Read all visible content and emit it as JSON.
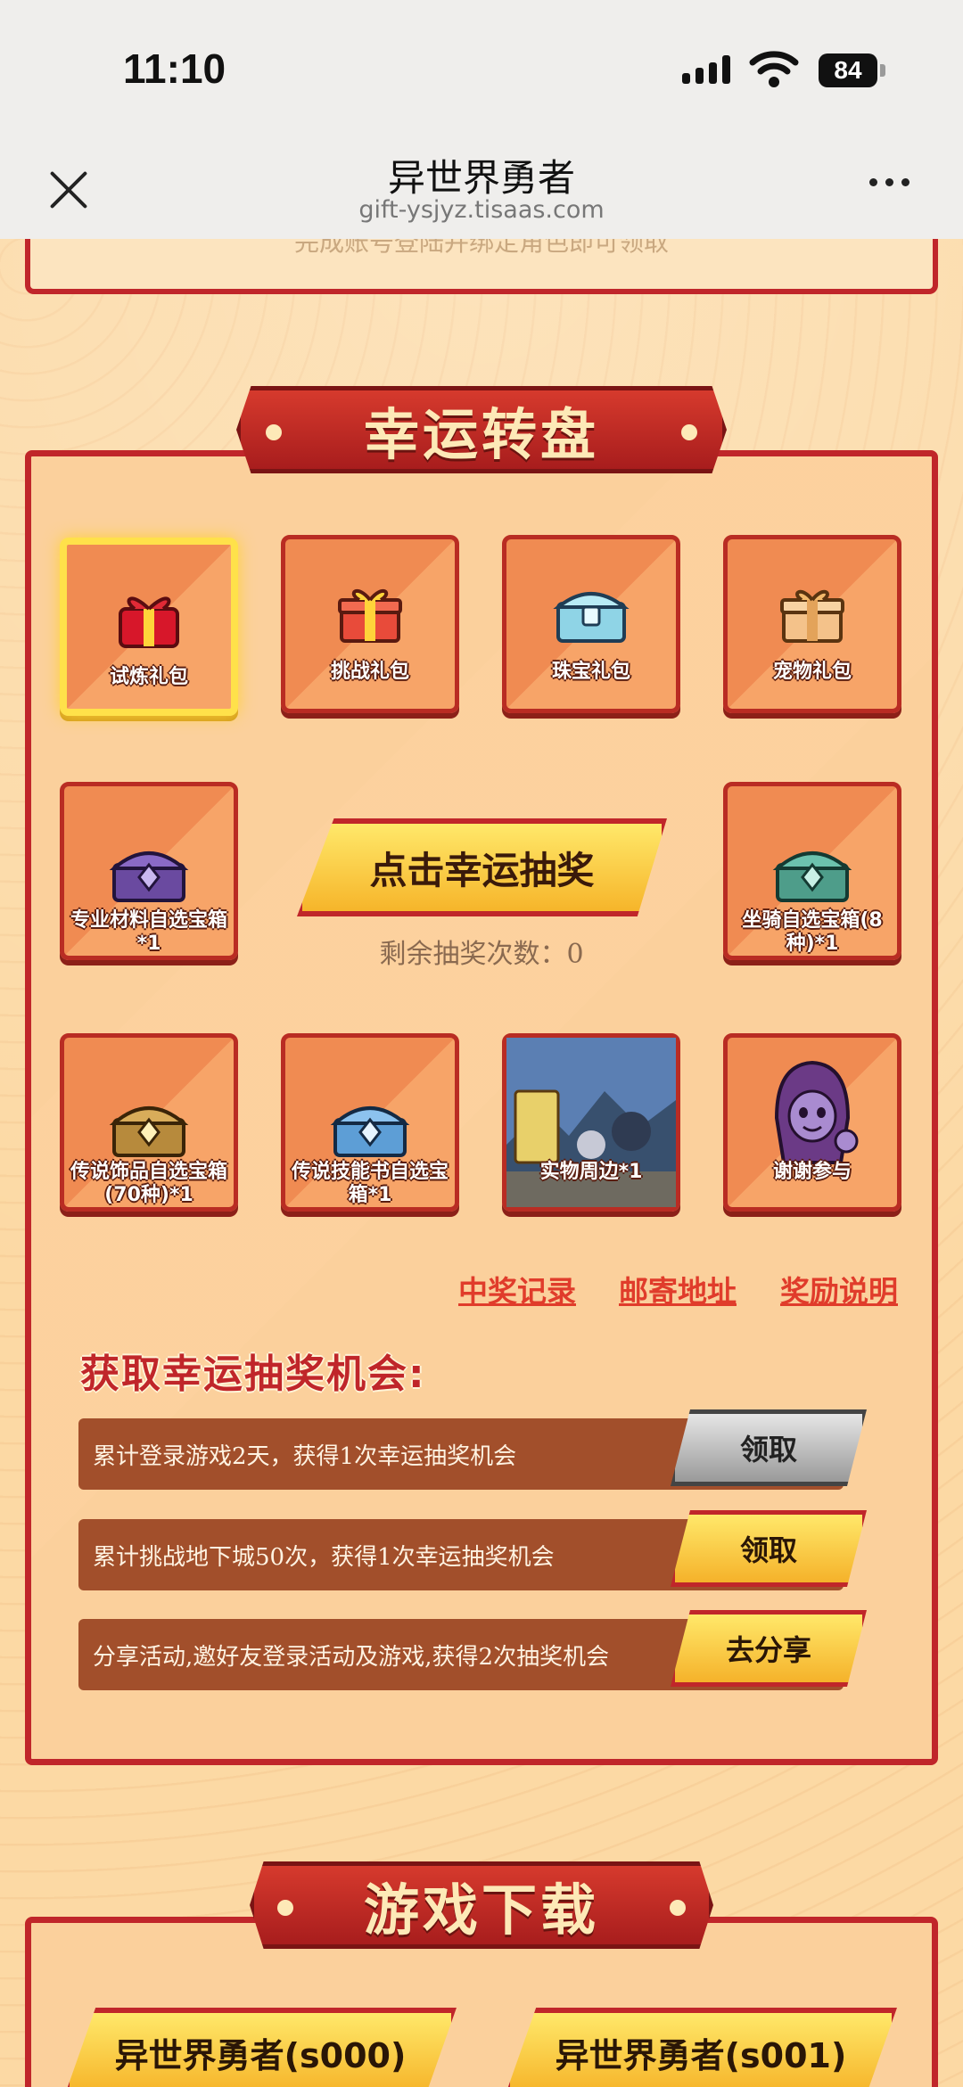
{
  "status_bar": {
    "time": "11:10",
    "battery": "84"
  },
  "browser": {
    "title": "异世界勇者",
    "url": "gift-ysjyz.tisaas.com"
  },
  "top_panel": {
    "note": "完成账号登陆并绑定角色即可领取"
  },
  "lucky_wheel": {
    "title": "幸运转盘",
    "prizes": [
      {
        "label": "试炼礼包",
        "icon": "red-gift-icon"
      },
      {
        "label": "挑战礼包",
        "icon": "gift-box-icon"
      },
      {
        "label": "珠宝礼包",
        "icon": "jewel-chest-icon"
      },
      {
        "label": "宠物礼包",
        "icon": "pet-gift-icon"
      },
      {
        "label": "专业材料自选宝箱*1",
        "icon": "purple-chest-icon"
      },
      {
        "label": "坐骑自选宝箱(8种)*1",
        "icon": "green-chest-icon"
      },
      {
        "label": "传说饰品自选宝箱(70种)*1",
        "icon": "gold-chest-icon"
      },
      {
        "label": "传说技能书自选宝箱*1",
        "icon": "blue-chest-icon"
      },
      {
        "label": "实物周边*1",
        "icon": "merch-photo"
      },
      {
        "label": "谢谢参与",
        "icon": "hooded-character-icon"
      }
    ],
    "draw_button": "点击幸运抽奖",
    "remaining": "剩余抽奖次数：0",
    "links": [
      "中奖记录",
      "邮寄地址",
      "奖励说明"
    ]
  },
  "chances": {
    "title": "获取幸运抽奖机会:",
    "tasks": [
      {
        "text": "累计登录游戏2天，获得1次幸运抽奖机会",
        "button": "领取",
        "state": "disabled"
      },
      {
        "text": "累计挑战地下城50次，获得1次幸运抽奖机会",
        "button": "领取",
        "state": "active"
      },
      {
        "text": "分享活动,邀好友登录活动及游戏,获得2次抽奖机会",
        "button": "去分享",
        "state": "active"
      }
    ]
  },
  "download": {
    "title": "游戏下载",
    "servers": [
      "异世界勇者(s000)",
      "异世界勇者(s001)"
    ]
  },
  "colors": {
    "frame_red": "#c0262a",
    "tile_orange": "#f08b52",
    "gold": "#f6b52a",
    "highlight": "#ffe14a"
  }
}
